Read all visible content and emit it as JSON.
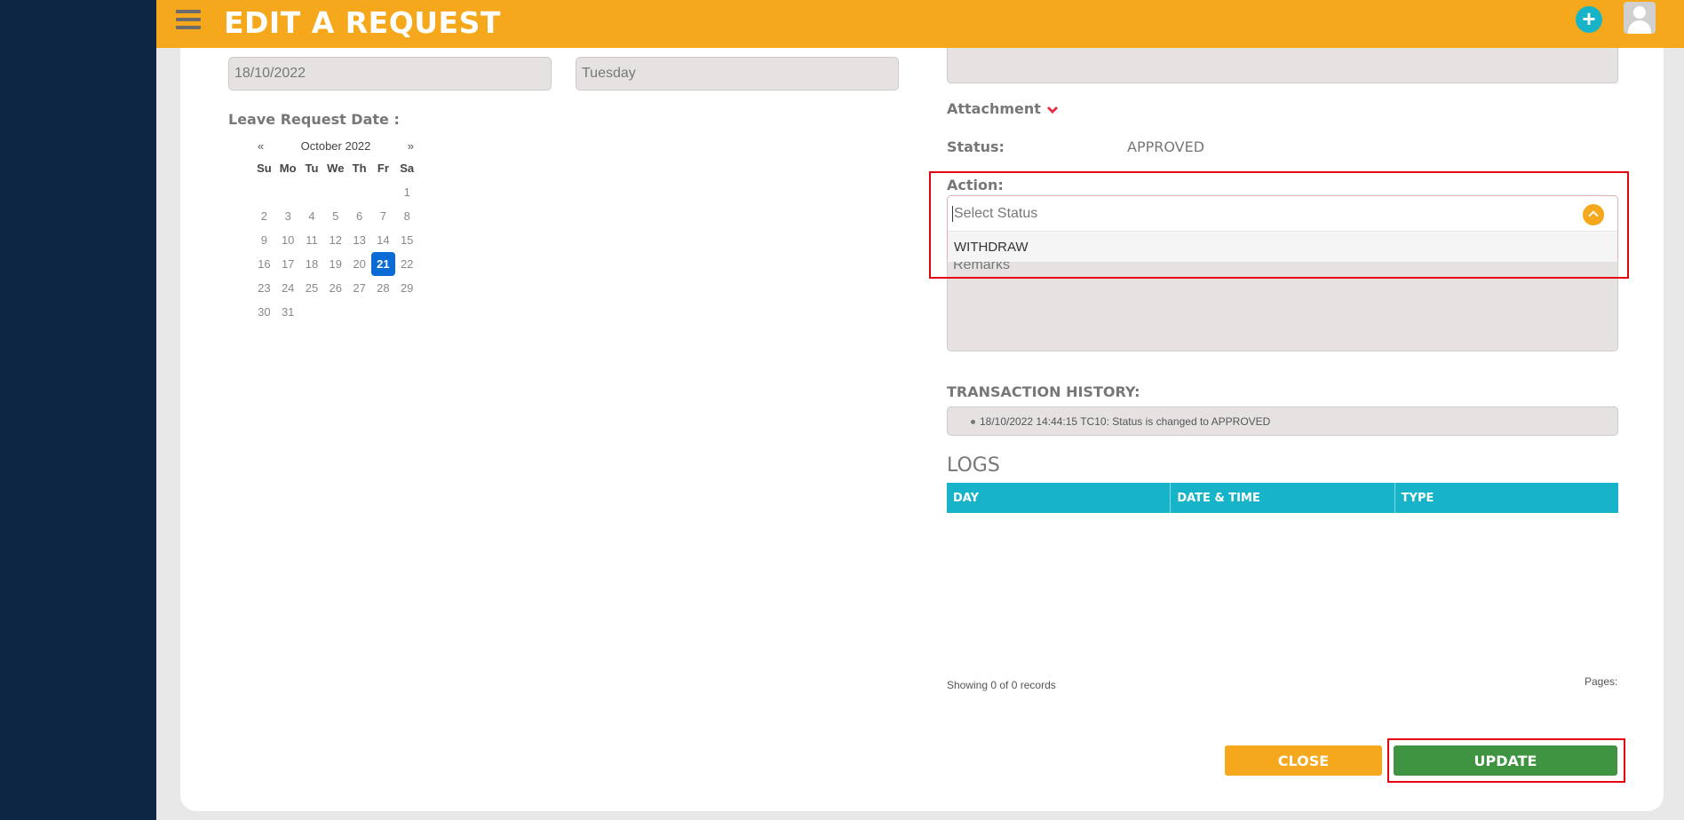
{
  "header": {
    "title": "EDIT A REQUEST"
  },
  "left": {
    "date_value": "18/10/2022",
    "day_value": "Tuesday",
    "leave_date_label": "Leave Request Date :"
  },
  "calendar": {
    "prev": "«",
    "next": "»",
    "month": "October 2022",
    "dows": [
      "Su",
      "Mo",
      "Tu",
      "We",
      "Th",
      "Fr",
      "Sa"
    ],
    "selected": "21",
    "weeks": [
      [
        "",
        "",
        "",
        "",
        "",
        "",
        "1"
      ],
      [
        "2",
        "3",
        "4",
        "5",
        "6",
        "7",
        "8"
      ],
      [
        "9",
        "10",
        "11",
        "12",
        "13",
        "14",
        "15"
      ],
      [
        "16",
        "17",
        "18",
        "19",
        "20",
        "21",
        "22"
      ],
      [
        "23",
        "24",
        "25",
        "26",
        "27",
        "28",
        "29"
      ],
      [
        "30",
        "31",
        "",
        "",
        "",
        "",
        ""
      ]
    ]
  },
  "right": {
    "attachment_label": "Attachment",
    "status_label": "Status:",
    "status_value": "APPROVED",
    "action_label": "Action:",
    "select_placeholder": "Select Status",
    "option_withdraw": "WITHDRAW",
    "remarks_placeholder": "Remarks",
    "history_label": "TRANSACTION HISTORY:",
    "history_item": "18/10/2022 14:44:15 TC10: Status is changed to APPROVED"
  },
  "logs": {
    "title": "LOGS",
    "columns": [
      "DAY",
      "DATE & TIME",
      "TYPE"
    ],
    "showing": "Showing 0 of 0 records",
    "pages": "Pages:"
  },
  "buttons": {
    "close": "CLOSE",
    "update": "UPDATE"
  },
  "colors": {
    "header": "#f5a81c",
    "sidebar": "#0c2643",
    "accent": "#17b4c9",
    "update": "#3e9441",
    "highlight": "#e60012"
  }
}
